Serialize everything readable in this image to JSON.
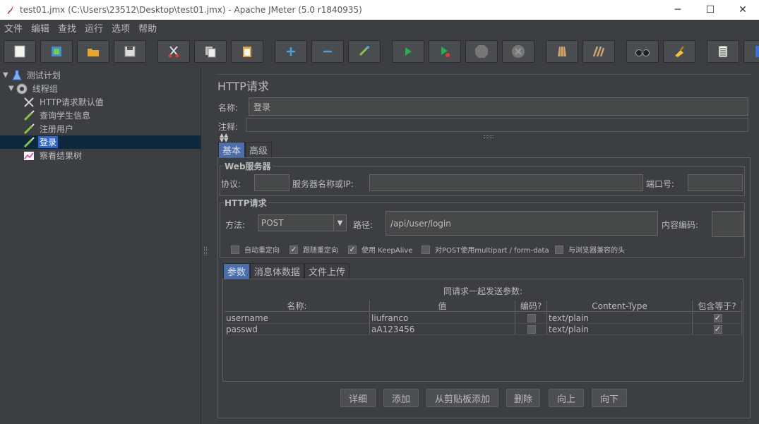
{
  "window": {
    "title": "test01.jmx (C:\\Users\\23512\\Desktop\\test01.jmx) - Apache JMeter (5.0 r1840935)",
    "minimize": "─",
    "maximize": "☐",
    "close": "✕"
  },
  "menu": [
    "文件",
    "编辑",
    "查找",
    "运行",
    "选项",
    "帮助"
  ],
  "toolbar": {
    "buttons": [
      "new-icon",
      "templates-icon",
      "open-icon",
      "save-icon",
      "cut-icon",
      "copy-icon",
      "paste-icon",
      "expand-icon",
      "collapse-icon",
      "toggle-icon",
      "start-icon",
      "start-no-timers-icon",
      "stop-icon",
      "shutdown-icon",
      "clear-icon",
      "clear-all-icon",
      "search-icon",
      "reset-search-icon",
      "function-helper-icon",
      "help-icon"
    ]
  },
  "tree": {
    "items": [
      {
        "label": "测试计划",
        "icon": "test-plan-icon"
      },
      {
        "label": "线程组",
        "icon": "thread-group-icon"
      },
      {
        "label": "HTTP请求默认值",
        "icon": "config-icon"
      },
      {
        "label": "查询学生信息",
        "icon": "sampler-icon"
      },
      {
        "label": "注册用户",
        "icon": "sampler-icon"
      },
      {
        "label": "登录",
        "icon": "sampler-icon",
        "selected": true
      },
      {
        "label": "察看结果树",
        "icon": "listener-icon"
      }
    ]
  },
  "main": {
    "title": "HTTP请求",
    "name_label": "名称:",
    "name_value": "登录",
    "comment_label": "注释:",
    "tabs": [
      "基本",
      "高级"
    ],
    "web_server": {
      "title": "Web服务器",
      "protocol_label": "协议:",
      "server_label": "服务器名称或IP:",
      "port_label": "端口号:"
    },
    "http_request": {
      "title": "HTTP请求",
      "method_label": "方法:",
      "method_value": "POST",
      "path_label": "路径:",
      "path_value": "/api/user/login",
      "encoding_label": "内容编码:"
    },
    "options": [
      {
        "label": "自动重定向",
        "checked": false
      },
      {
        "label": "跟随重定向",
        "checked": true
      },
      {
        "label": "使用 KeepAlive",
        "checked": true
      },
      {
        "label": "对POST使用multipart / form-data",
        "checked": false
      },
      {
        "label": "与浏览器兼容的头",
        "checked": false
      }
    ],
    "param_tabs": [
      "参数",
      "消息体数据",
      "文件上传"
    ],
    "params_caption": "同请求一起发送参数:",
    "columns": [
      "名称:",
      "值",
      "编码?",
      "Content-Type",
      "包含等于?"
    ],
    "rows": [
      {
        "name": "username",
        "value": "liufranco",
        "encode": false,
        "content_type": "text/plain",
        "include_equals": true
      },
      {
        "name": "passwd",
        "value": "aA123456",
        "encode": false,
        "content_type": "text/plain",
        "include_equals": true
      }
    ],
    "buttons": [
      "详细",
      "添加",
      "从剪贴板添加",
      "删除",
      "向上",
      "向下"
    ]
  }
}
